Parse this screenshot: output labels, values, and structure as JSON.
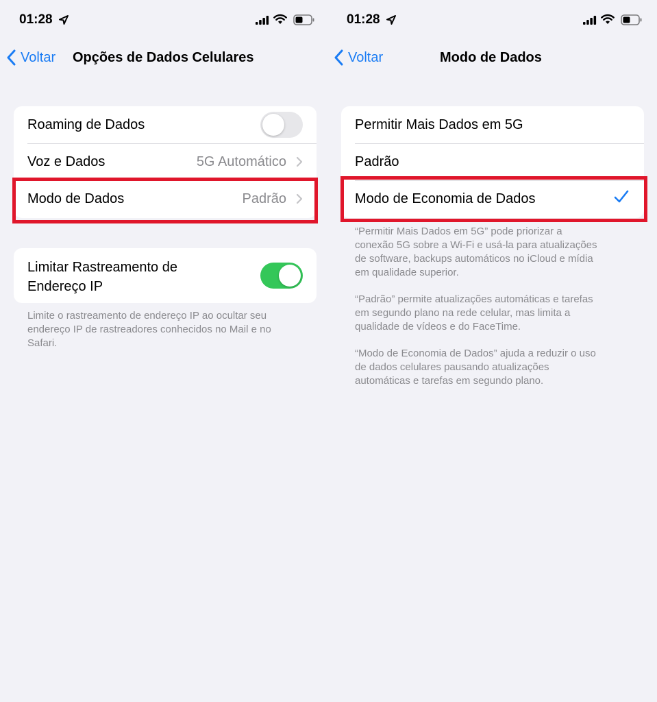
{
  "left": {
    "status": {
      "time": "01:28"
    },
    "nav": {
      "back_label": "Voltar",
      "title": "Opções de Dados Celulares"
    },
    "group1": {
      "roaming": {
        "label": "Roaming de Dados",
        "toggle": "off"
      },
      "voice": {
        "label": "Voz e Dados",
        "value": "5G Automático"
      },
      "mode": {
        "label": "Modo de Dados",
        "value": "Padrão"
      }
    },
    "group2": {
      "ip_label_line1": "Limitar Rastreamento de",
      "ip_label_line2": "Endereço IP",
      "toggle": "on"
    },
    "footnote": {
      "line1": "Limite o rastreamento de endereço IP ao ocultar seu",
      "line2": "endereço IP de rastreadores conhecidos no Mail e no",
      "line3": "Safari."
    }
  },
  "right": {
    "status": {
      "time": "01:28"
    },
    "nav": {
      "back_label": "Voltar",
      "title": "Modo de Dados"
    },
    "options": [
      {
        "label": "Permitir Mais Dados em 5G",
        "selected": false
      },
      {
        "label": "Padrão",
        "selected": false
      },
      {
        "label": "Modo de Economia de Dados",
        "selected": true
      }
    ],
    "footnote1": {
      "line1": "“Permitir Mais Dados em 5G” pode priorizar a",
      "line2": "conexão 5G sobre a Wi-Fi e usá-la para atualizações",
      "line3": "de software, backups automáticos no iCloud e mídia",
      "line4": "em qualidade superior."
    },
    "footnote2": {
      "line1": "“Padrão” permite atualizações automáticas e tarefas",
      "line2": "em segundo plano na rede celular, mas limita a",
      "line3": "qualidade de vídeos e do FaceTime."
    },
    "footnote3": {
      "line1": "“Modo de Economia de Dados” ajuda a reduzir o uso",
      "line2": "de dados celulares pausando atualizações",
      "line3": "automáticas e tarefas em segundo plano."
    }
  },
  "colors": {
    "accent": "#1a7cf4",
    "toggle_on": "#34c759",
    "highlight": "#e0162b",
    "background": "#f2f2f7"
  },
  "icons": [
    "location-arrow-icon",
    "cellular-signal-icon",
    "wifi-icon",
    "battery-icon",
    "back-chevron-icon",
    "disclosure-chevron-icon",
    "checkmark-icon"
  ]
}
